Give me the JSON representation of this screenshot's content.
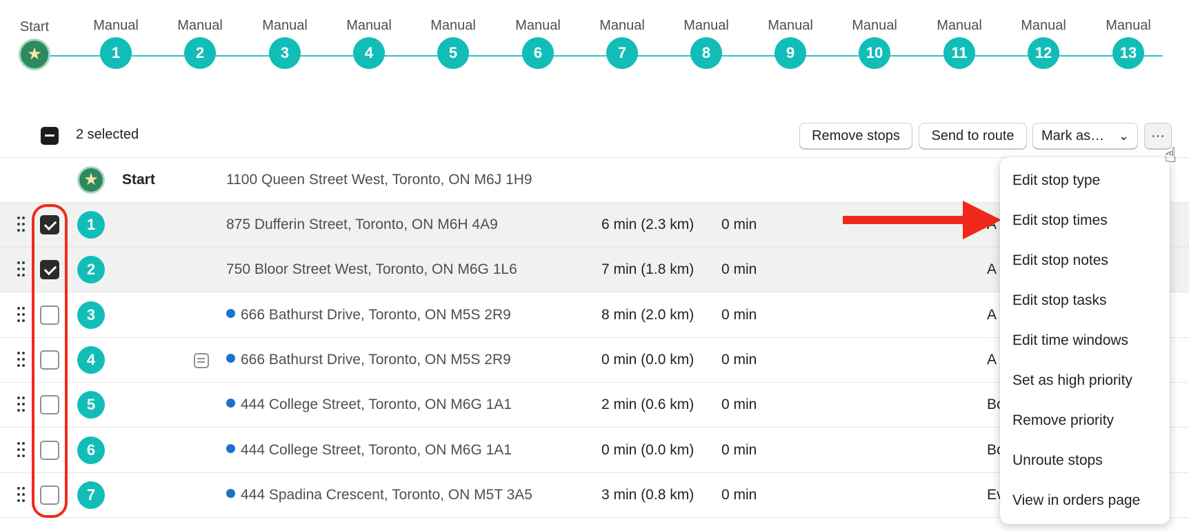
{
  "timeline": {
    "nodes": [
      {
        "label": "Start",
        "marker": "star-icon"
      },
      {
        "label": "Manual",
        "marker": "1"
      },
      {
        "label": "Manual",
        "marker": "2"
      },
      {
        "label": "Manual",
        "marker": "3"
      },
      {
        "label": "Manual",
        "marker": "4"
      },
      {
        "label": "Manual",
        "marker": "5"
      },
      {
        "label": "Manual",
        "marker": "6"
      },
      {
        "label": "Manual",
        "marker": "7"
      },
      {
        "label": "Manual",
        "marker": "8"
      },
      {
        "label": "Manual",
        "marker": "9"
      },
      {
        "label": "Manual",
        "marker": "10"
      },
      {
        "label": "Manual",
        "marker": "11"
      },
      {
        "label": "Manual",
        "marker": "12"
      },
      {
        "label": "Manual",
        "marker": "13"
      }
    ]
  },
  "bulk": {
    "selected_text": "2 selected",
    "remove_label": "Remove stops",
    "send_label": "Send to route",
    "mark_label": "Mark as…",
    "more_label": "···"
  },
  "start_row": {
    "label": "Start",
    "address": "1100 Queen Street West, Toronto, ON M6J 1H9"
  },
  "rows": [
    {
      "num": "1",
      "checked": true,
      "address": "875 Dufferin Street, Toronto, ON M6H 4A9",
      "dot": false,
      "note": false,
      "travel": "6 min (2.3 km)",
      "service": "0 min",
      "eta": "A"
    },
    {
      "num": "2",
      "checked": true,
      "address": "750 Bloor Street West, Toronto, ON M6G 1L6",
      "dot": false,
      "note": false,
      "travel": "7 min (1.8 km)",
      "service": "0 min",
      "eta": "A"
    },
    {
      "num": "3",
      "checked": false,
      "address": "666 Bathurst Drive, Toronto, ON M5S 2R9",
      "dot": true,
      "note": false,
      "travel": "8 min (2.0 km)",
      "service": "0 min",
      "eta": "A"
    },
    {
      "num": "4",
      "checked": false,
      "address": "666 Bathurst Drive, Toronto, ON M5S 2R9",
      "dot": true,
      "note": true,
      "travel": "0 min (0.0 km)",
      "service": "0 min",
      "eta": "A"
    },
    {
      "num": "5",
      "checked": false,
      "address": "444 College Street, Toronto, ON M6G 1A1",
      "dot": true,
      "note": false,
      "travel": "2 min (0.6 km)",
      "service": "0 min",
      "eta": "Bo"
    },
    {
      "num": "6",
      "checked": false,
      "address": "444 College Street, Toronto, ON M6G 1A1",
      "dot": true,
      "note": false,
      "travel": "0 min (0.0 km)",
      "service": "0 min",
      "eta": "Bo"
    },
    {
      "num": "7",
      "checked": false,
      "address": "444 Spadina Crescent, Toronto, ON M5T 3A5",
      "dot": true,
      "note": false,
      "travel": "3 min (0.8 km)",
      "service": "0 min",
      "eta": "Ev"
    }
  ],
  "menu": {
    "items": [
      "Edit stop type",
      "Edit stop times",
      "Edit stop notes",
      "Edit stop tasks",
      "Edit time windows",
      "Set as high priority",
      "Remove priority",
      "Unroute stops",
      "View in orders page"
    ]
  },
  "colors": {
    "teal": "#12bdb8",
    "start_green": "#2e8a5e",
    "annotation_red": "#f02a1a",
    "dot_blue": "#1a73c9"
  }
}
